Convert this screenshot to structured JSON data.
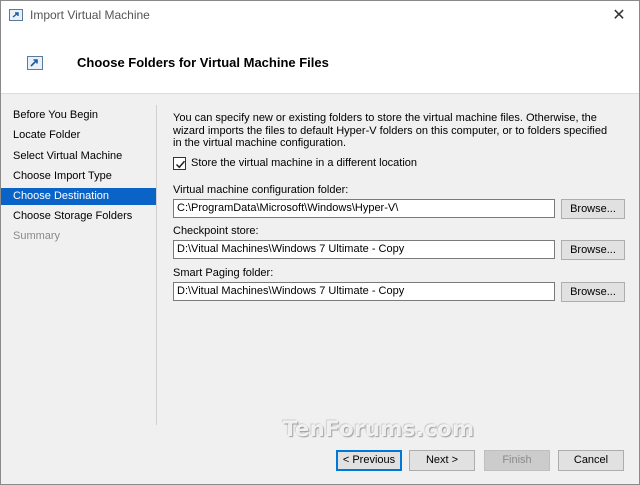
{
  "window": {
    "title": "Import Virtual Machine",
    "close_glyph": "✕"
  },
  "header": {
    "title": "Choose Folders for Virtual Machine Files"
  },
  "nav": {
    "items": [
      {
        "label": "Before You Begin"
      },
      {
        "label": "Locate Folder"
      },
      {
        "label": "Select Virtual Machine"
      },
      {
        "label": "Choose Import Type"
      },
      {
        "label": "Choose Destination"
      },
      {
        "label": "Choose Storage Folders"
      },
      {
        "label": "Summary"
      }
    ],
    "selected": "Choose Destination",
    "disabled": "Summary"
  },
  "content": {
    "description": "You can specify new or existing folders to store the virtual machine files. Otherwise, the wizard imports the files to default Hyper-V folders on this computer, or to folders specified in the virtual machine configuration.",
    "different_location": {
      "label": "Store the virtual machine in a different location",
      "checked": true
    },
    "config_folder": {
      "label": "Virtual machine configuration folder:",
      "value": "C:\\ProgramData\\Microsoft\\Windows\\Hyper-V\\",
      "browse": "Browse..."
    },
    "checkpoint_store": {
      "label": "Checkpoint store:",
      "value": "D:\\Vitual Machines\\Windows 7 Ultimate - Copy",
      "browse": "Browse..."
    },
    "smart_paging": {
      "label": "Smart Paging folder:",
      "value": "D:\\Vitual Machines\\Windows 7 Ultimate - Copy",
      "browse": "Browse..."
    }
  },
  "watermark": "TenForums.com",
  "buttons": {
    "previous": "< Previous",
    "next": "Next >",
    "finish": "Finish",
    "cancel": "Cancel"
  },
  "colors": {
    "selection": "#0a64c8",
    "default_button_border": "#0078d7"
  }
}
